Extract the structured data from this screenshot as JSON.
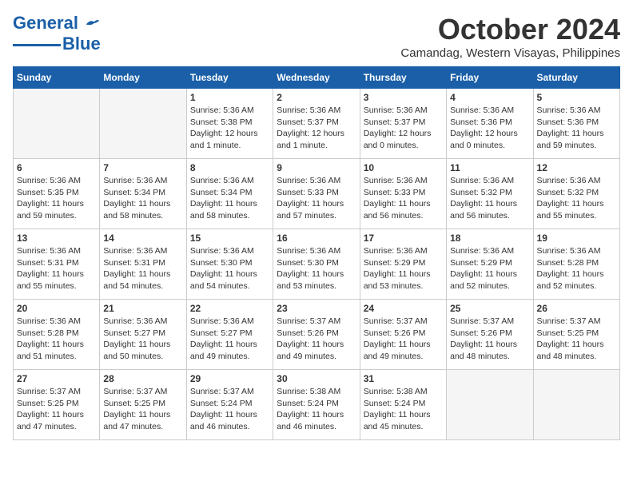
{
  "header": {
    "logo_text_general": "General",
    "logo_text_blue": "Blue",
    "month_title": "October 2024",
    "subtitle": "Camandag, Western Visayas, Philippines"
  },
  "days_of_week": [
    "Sunday",
    "Monday",
    "Tuesday",
    "Wednesday",
    "Thursday",
    "Friday",
    "Saturday"
  ],
  "weeks": [
    [
      {
        "day": "",
        "info": ""
      },
      {
        "day": "",
        "info": ""
      },
      {
        "day": "1",
        "info": "Sunrise: 5:36 AM\nSunset: 5:38 PM\nDaylight: 12 hours\nand 1 minute."
      },
      {
        "day": "2",
        "info": "Sunrise: 5:36 AM\nSunset: 5:37 PM\nDaylight: 12 hours\nand 1 minute."
      },
      {
        "day": "3",
        "info": "Sunrise: 5:36 AM\nSunset: 5:37 PM\nDaylight: 12 hours\nand 0 minutes."
      },
      {
        "day": "4",
        "info": "Sunrise: 5:36 AM\nSunset: 5:36 PM\nDaylight: 12 hours\nand 0 minutes."
      },
      {
        "day": "5",
        "info": "Sunrise: 5:36 AM\nSunset: 5:36 PM\nDaylight: 11 hours\nand 59 minutes."
      }
    ],
    [
      {
        "day": "6",
        "info": "Sunrise: 5:36 AM\nSunset: 5:35 PM\nDaylight: 11 hours\nand 59 minutes."
      },
      {
        "day": "7",
        "info": "Sunrise: 5:36 AM\nSunset: 5:34 PM\nDaylight: 11 hours\nand 58 minutes."
      },
      {
        "day": "8",
        "info": "Sunrise: 5:36 AM\nSunset: 5:34 PM\nDaylight: 11 hours\nand 58 minutes."
      },
      {
        "day": "9",
        "info": "Sunrise: 5:36 AM\nSunset: 5:33 PM\nDaylight: 11 hours\nand 57 minutes."
      },
      {
        "day": "10",
        "info": "Sunrise: 5:36 AM\nSunset: 5:33 PM\nDaylight: 11 hours\nand 56 minutes."
      },
      {
        "day": "11",
        "info": "Sunrise: 5:36 AM\nSunset: 5:32 PM\nDaylight: 11 hours\nand 56 minutes."
      },
      {
        "day": "12",
        "info": "Sunrise: 5:36 AM\nSunset: 5:32 PM\nDaylight: 11 hours\nand 55 minutes."
      }
    ],
    [
      {
        "day": "13",
        "info": "Sunrise: 5:36 AM\nSunset: 5:31 PM\nDaylight: 11 hours\nand 55 minutes."
      },
      {
        "day": "14",
        "info": "Sunrise: 5:36 AM\nSunset: 5:31 PM\nDaylight: 11 hours\nand 54 minutes."
      },
      {
        "day": "15",
        "info": "Sunrise: 5:36 AM\nSunset: 5:30 PM\nDaylight: 11 hours\nand 54 minutes."
      },
      {
        "day": "16",
        "info": "Sunrise: 5:36 AM\nSunset: 5:30 PM\nDaylight: 11 hours\nand 53 minutes."
      },
      {
        "day": "17",
        "info": "Sunrise: 5:36 AM\nSunset: 5:29 PM\nDaylight: 11 hours\nand 53 minutes."
      },
      {
        "day": "18",
        "info": "Sunrise: 5:36 AM\nSunset: 5:29 PM\nDaylight: 11 hours\nand 52 minutes."
      },
      {
        "day": "19",
        "info": "Sunrise: 5:36 AM\nSunset: 5:28 PM\nDaylight: 11 hours\nand 52 minutes."
      }
    ],
    [
      {
        "day": "20",
        "info": "Sunrise: 5:36 AM\nSunset: 5:28 PM\nDaylight: 11 hours\nand 51 minutes."
      },
      {
        "day": "21",
        "info": "Sunrise: 5:36 AM\nSunset: 5:27 PM\nDaylight: 11 hours\nand 50 minutes."
      },
      {
        "day": "22",
        "info": "Sunrise: 5:36 AM\nSunset: 5:27 PM\nDaylight: 11 hours\nand 49 minutes."
      },
      {
        "day": "23",
        "info": "Sunrise: 5:37 AM\nSunset: 5:26 PM\nDaylight: 11 hours\nand 49 minutes."
      },
      {
        "day": "24",
        "info": "Sunrise: 5:37 AM\nSunset: 5:26 PM\nDaylight: 11 hours\nand 49 minutes."
      },
      {
        "day": "25",
        "info": "Sunrise: 5:37 AM\nSunset: 5:26 PM\nDaylight: 11 hours\nand 48 minutes."
      },
      {
        "day": "26",
        "info": "Sunrise: 5:37 AM\nSunset: 5:25 PM\nDaylight: 11 hours\nand 48 minutes."
      }
    ],
    [
      {
        "day": "27",
        "info": "Sunrise: 5:37 AM\nSunset: 5:25 PM\nDaylight: 11 hours\nand 47 minutes."
      },
      {
        "day": "28",
        "info": "Sunrise: 5:37 AM\nSunset: 5:25 PM\nDaylight: 11 hours\nand 47 minutes."
      },
      {
        "day": "29",
        "info": "Sunrise: 5:37 AM\nSunset: 5:24 PM\nDaylight: 11 hours\nand 46 minutes."
      },
      {
        "day": "30",
        "info": "Sunrise: 5:38 AM\nSunset: 5:24 PM\nDaylight: 11 hours\nand 46 minutes."
      },
      {
        "day": "31",
        "info": "Sunrise: 5:38 AM\nSunset: 5:24 PM\nDaylight: 11 hours\nand 45 minutes."
      },
      {
        "day": "",
        "info": ""
      },
      {
        "day": "",
        "info": ""
      }
    ]
  ]
}
